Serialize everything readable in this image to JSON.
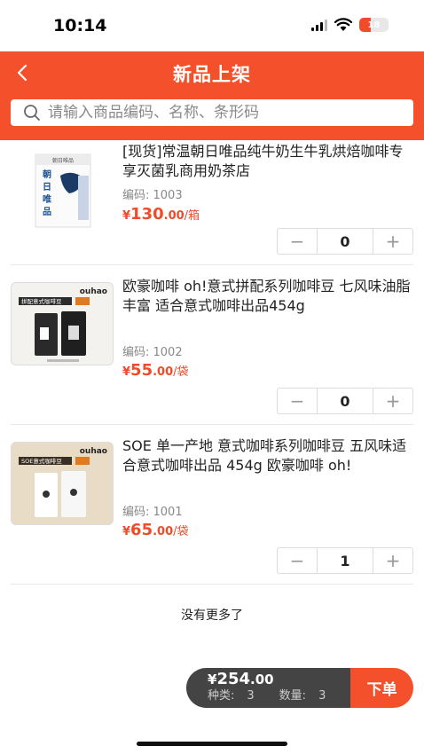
{
  "status_bar": {
    "time": "10:14",
    "battery_level": "18"
  },
  "header": {
    "title": "新品上架",
    "back_icon": "chevron-left-icon",
    "search_placeholder": "请输入商品编码、名称、条形码"
  },
  "products": [
    {
      "name": "[现货]常温朝日唯品纯牛奶生牛乳烘焙咖啡专享灭菌乳商用奶茶店",
      "code": "编码: 1003",
      "price_symbol": "¥",
      "price_int": "130",
      "price_dec": ".00",
      "price_unit": "/箱",
      "quantity": "0",
      "image_brand": "朝日唯品",
      "image_text": "朝日唯品"
    },
    {
      "name": "欧豪咖啡 oh!意式拼配系列咖啡豆 七风味油脂丰富 适合意式咖啡出品454g",
      "code": "编码: 1002",
      "price_symbol": "¥",
      "price_int": "55",
      "price_dec": ".00",
      "price_unit": "/袋",
      "quantity": "0",
      "image_brand": "ouhao",
      "image_banner": "拼配意式咖啡豆"
    },
    {
      "name": "SOE 单一产地 意式咖啡系列咖啡豆 五风味适合意式咖啡出品 454g 欧豪咖啡 oh!",
      "code": "编码: 1001",
      "price_symbol": "¥",
      "price_int": "65",
      "price_dec": ".00",
      "price_unit": "/袋",
      "quantity": "1",
      "image_brand": "ouhao",
      "image_banner": "SOE意式咖啡豆"
    }
  ],
  "stepper": {
    "minus": "−",
    "plus": "+"
  },
  "list_footer": "没有更多了",
  "cart": {
    "price_symbol": "¥",
    "total_int": "254",
    "total_dec": ".00",
    "categories_label": "种类:",
    "categories_value": "3",
    "quantity_label": "数量:",
    "quantity_value": "3",
    "order_button": "下单"
  },
  "colors": {
    "brand": "#f5502c",
    "price": "#f04b2a",
    "cart_bg": "#444444"
  }
}
